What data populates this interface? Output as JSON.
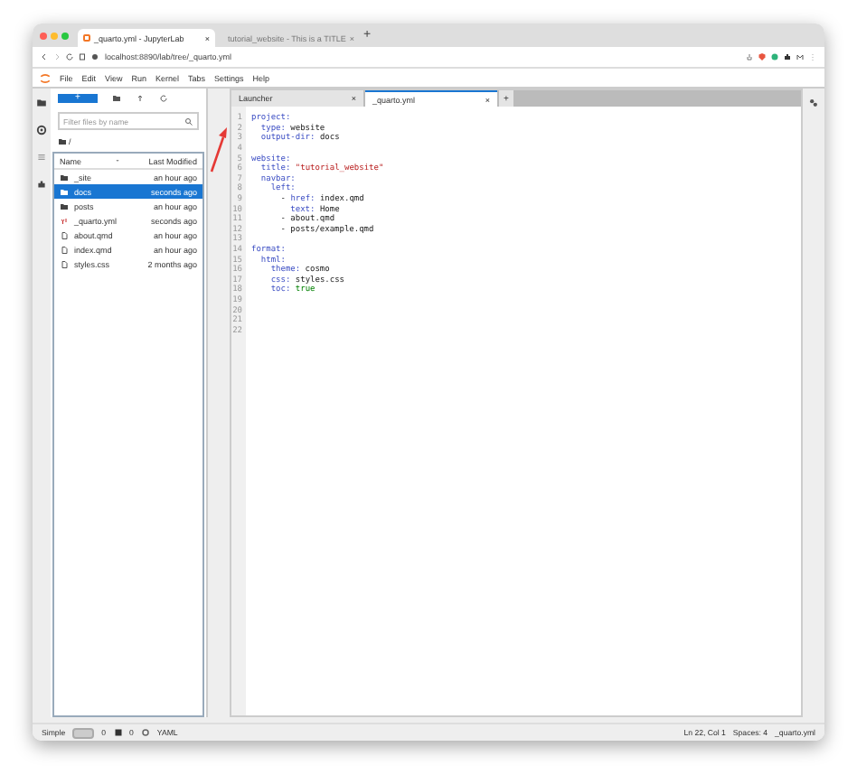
{
  "browser": {
    "tabs": [
      {
        "title": "_quarto.yml - JupyterLab",
        "selected": true
      },
      {
        "title": "tutorial_website - This is a TITLE",
        "selected": false
      }
    ],
    "tab_close": "×",
    "new_tab": "+",
    "url": "localhost:8890/lab/tree/_quarto.yml"
  },
  "menu": [
    "File",
    "Edit",
    "View",
    "Run",
    "Kernel",
    "Tabs",
    "Settings",
    "Help"
  ],
  "file_browser": {
    "new_button": "+",
    "filter": {
      "placeholder": "Filter files by name"
    },
    "path": "/",
    "columns": [
      "Name",
      "Last Modified"
    ],
    "rows": [
      {
        "name": "_site",
        "kind": "folder",
        "modified": "an hour ago",
        "selected": false
      },
      {
        "name": "docs",
        "kind": "folder",
        "modified": "seconds ago",
        "selected": true
      },
      {
        "name": "posts",
        "kind": "folder",
        "modified": "an hour ago",
        "selected": false
      },
      {
        "name": "_quarto.yml",
        "kind": "yaml",
        "modified": "seconds ago",
        "selected": false
      },
      {
        "name": "about.qmd",
        "kind": "file",
        "modified": "an hour ago",
        "selected": false
      },
      {
        "name": "index.qmd",
        "kind": "file",
        "modified": "an hour ago",
        "selected": false
      },
      {
        "name": "styles.css",
        "kind": "file",
        "modified": "2 months ago",
        "selected": false
      }
    ]
  },
  "editor": {
    "tab_close": "×",
    "add_tab": "+",
    "tabs": [
      {
        "title": "Launcher",
        "selected": false
      },
      {
        "title": "_quarto.yml",
        "selected": true
      }
    ],
    "lines": [
      {
        "number": "1",
        "tokens": [
          {
            "kind": "key",
            "text": "project:"
          }
        ]
      },
      {
        "number": "2",
        "tokens": [
          {
            "kind": "key",
            "text": "  type:"
          },
          {
            "kind": "plain",
            "text": " website"
          }
        ]
      },
      {
        "number": "3",
        "tokens": [
          {
            "kind": "key",
            "text": "  output-dir:"
          },
          {
            "kind": "plain",
            "text": " docs"
          }
        ]
      },
      {
        "number": "4"
      },
      {
        "number": "5",
        "tokens": [
          {
            "kind": "key",
            "text": "website:"
          }
        ]
      },
      {
        "number": "6",
        "tokens": [
          {
            "kind": "key",
            "text": "  title:"
          },
          {
            "kind": "string",
            "text": " \"tutorial_website\""
          }
        ]
      },
      {
        "number": "7",
        "tokens": [
          {
            "kind": "key",
            "text": "  navbar:"
          }
        ]
      },
      {
        "number": "8",
        "tokens": [
          {
            "kind": "key",
            "text": "    left:"
          }
        ]
      },
      {
        "number": "9",
        "tokens": [
          {
            "kind": "plain",
            "text": "      - "
          },
          {
            "kind": "key",
            "text": "href:"
          },
          {
            "kind": "plain",
            "text": " index.qmd"
          }
        ]
      },
      {
        "number": "10",
        "tokens": [
          {
            "kind": "key",
            "text": "        text:"
          },
          {
            "kind": "plain",
            "text": " Home"
          }
        ]
      },
      {
        "number": "11",
        "tokens": [
          {
            "kind": "plain",
            "text": "      - about.qmd"
          }
        ]
      },
      {
        "number": "12",
        "tokens": [
          {
            "kind": "plain",
            "text": "      - posts/example.qmd"
          }
        ]
      },
      {
        "number": "13"
      },
      {
        "number": "14",
        "tokens": [
          {
            "kind": "key",
            "text": "format:"
          }
        ]
      },
      {
        "number": "15",
        "tokens": [
          {
            "kind": "key",
            "text": "  html:"
          }
        ]
      },
      {
        "number": "16",
        "tokens": [
          {
            "kind": "key",
            "text": "    theme:"
          },
          {
            "kind": "plain",
            "text": " cosmo"
          }
        ]
      },
      {
        "number": "17",
        "tokens": [
          {
            "kind": "key",
            "text": "    css:"
          },
          {
            "kind": "plain",
            "text": " styles.css"
          }
        ]
      },
      {
        "number": "18",
        "tokens": [
          {
            "kind": "key",
            "text": "    toc:"
          },
          {
            "kind": "bool",
            "text": " true"
          }
        ]
      },
      {
        "number": "19"
      },
      {
        "number": "20"
      },
      {
        "number": "21"
      },
      {
        "number": "22"
      }
    ]
  },
  "status_bar": {
    "mode": "Simple",
    "simple_on": false,
    "terminals": "0",
    "kernels": "0",
    "language": "YAML",
    "position": "Ln 22, Col 1",
    "spaces": "Spaces: 4",
    "file": "_quarto.yml"
  }
}
